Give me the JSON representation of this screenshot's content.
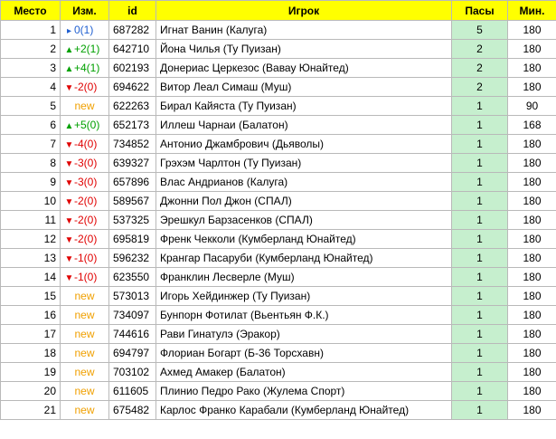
{
  "headers": {
    "place": "Место",
    "change": "Изм.",
    "id": "id",
    "player": "Игрок",
    "passes": "Пасы",
    "minutes": "Мин."
  },
  "rows": [
    {
      "place": "1",
      "dir": "same",
      "change": "0(1)",
      "id": "687282",
      "player": "Игнат Ванин (Калуга)",
      "passes": "5",
      "minutes": "180"
    },
    {
      "place": "2",
      "dir": "up",
      "change": "+2(1)",
      "id": "642710",
      "player": "Йона Чилья (Ту Пуизан)",
      "passes": "2",
      "minutes": "180"
    },
    {
      "place": "3",
      "dir": "up",
      "change": "+4(1)",
      "id": "602193",
      "player": "Донериас Церкезос (Вавау Юнайтед)",
      "passes": "2",
      "minutes": "180"
    },
    {
      "place": "4",
      "dir": "down",
      "change": "-2(0)",
      "id": "694622",
      "player": "Витор Леал Симаш (Муш)",
      "passes": "2",
      "minutes": "180"
    },
    {
      "place": "5",
      "dir": "new",
      "change": "new",
      "id": "622263",
      "player": "Бирал Кайяста (Ту Пуизан)",
      "passes": "1",
      "minutes": "90"
    },
    {
      "place": "6",
      "dir": "up",
      "change": "+5(0)",
      "id": "652173",
      "player": "Иллеш Чарнаи (Балатон)",
      "passes": "1",
      "minutes": "168"
    },
    {
      "place": "7",
      "dir": "down",
      "change": "-4(0)",
      "id": "734852",
      "player": "Антонио Джамбрович (Дьяволы)",
      "passes": "1",
      "minutes": "180"
    },
    {
      "place": "8",
      "dir": "down",
      "change": "-3(0)",
      "id": "639327",
      "player": "Грэхэм Чарлтон (Ту Пуизан)",
      "passes": "1",
      "minutes": "180"
    },
    {
      "place": "9",
      "dir": "down",
      "change": "-3(0)",
      "id": "657896",
      "player": "Влас Андрианов (Калуга)",
      "passes": "1",
      "minutes": "180"
    },
    {
      "place": "10",
      "dir": "down",
      "change": "-2(0)",
      "id": "589567",
      "player": "Джонни Пол Джон (СПАЛ)",
      "passes": "1",
      "minutes": "180"
    },
    {
      "place": "11",
      "dir": "down",
      "change": "-2(0)",
      "id": "537325",
      "player": "Эрешкул Барзасенков (СПАЛ)",
      "passes": "1",
      "minutes": "180"
    },
    {
      "place": "12",
      "dir": "down",
      "change": "-2(0)",
      "id": "695819",
      "player": "Френк Чекколи (Кумберланд Юнайтед)",
      "passes": "1",
      "minutes": "180"
    },
    {
      "place": "13",
      "dir": "down",
      "change": "-1(0)",
      "id": "596232",
      "player": "Крангар Пасаруби (Кумберланд Юнайтед)",
      "passes": "1",
      "minutes": "180"
    },
    {
      "place": "14",
      "dir": "down",
      "change": "-1(0)",
      "id": "623550",
      "player": "Франклин Лесверле (Муш)",
      "passes": "1",
      "minutes": "180"
    },
    {
      "place": "15",
      "dir": "new",
      "change": "new",
      "id": "573013",
      "player": "Игорь Хейдинжер (Ту Пуизан)",
      "passes": "1",
      "minutes": "180"
    },
    {
      "place": "16",
      "dir": "new",
      "change": "new",
      "id": "734097",
      "player": "Бунпорн Фотилат (Вьентьян Ф.К.)",
      "passes": "1",
      "minutes": "180"
    },
    {
      "place": "17",
      "dir": "new",
      "change": "new",
      "id": "744616",
      "player": "Рави Гинатулэ (Эракор)",
      "passes": "1",
      "minutes": "180"
    },
    {
      "place": "18",
      "dir": "new",
      "change": "new",
      "id": "694797",
      "player": "Флориан Богарт (Б-36 Торсхавн)",
      "passes": "1",
      "minutes": "180"
    },
    {
      "place": "19",
      "dir": "new",
      "change": "new",
      "id": "703102",
      "player": "Ахмед Амакер (Балатон)",
      "passes": "1",
      "minutes": "180"
    },
    {
      "place": "20",
      "dir": "new",
      "change": "new",
      "id": "611605",
      "player": "Плинио Педро Рако (Жулема Спорт)",
      "passes": "1",
      "minutes": "180"
    },
    {
      "place": "21",
      "dir": "new",
      "change": "new",
      "id": "675482",
      "player": "Карлос Франко Карабали (Кумберланд Юнайтед)",
      "passes": "1",
      "minutes": "180"
    }
  ],
  "colors": {
    "header_bg": "#ffff00",
    "passes_bg": "#c6efce",
    "up": "#00a000",
    "down": "#e00000",
    "same": "#1f5fd0",
    "new": "#f0a000",
    "grid_line": "#b9b9b9"
  },
  "icons": {
    "up": "triangle-up-icon",
    "down": "triangle-down-icon",
    "same": "triangle-right-icon"
  }
}
